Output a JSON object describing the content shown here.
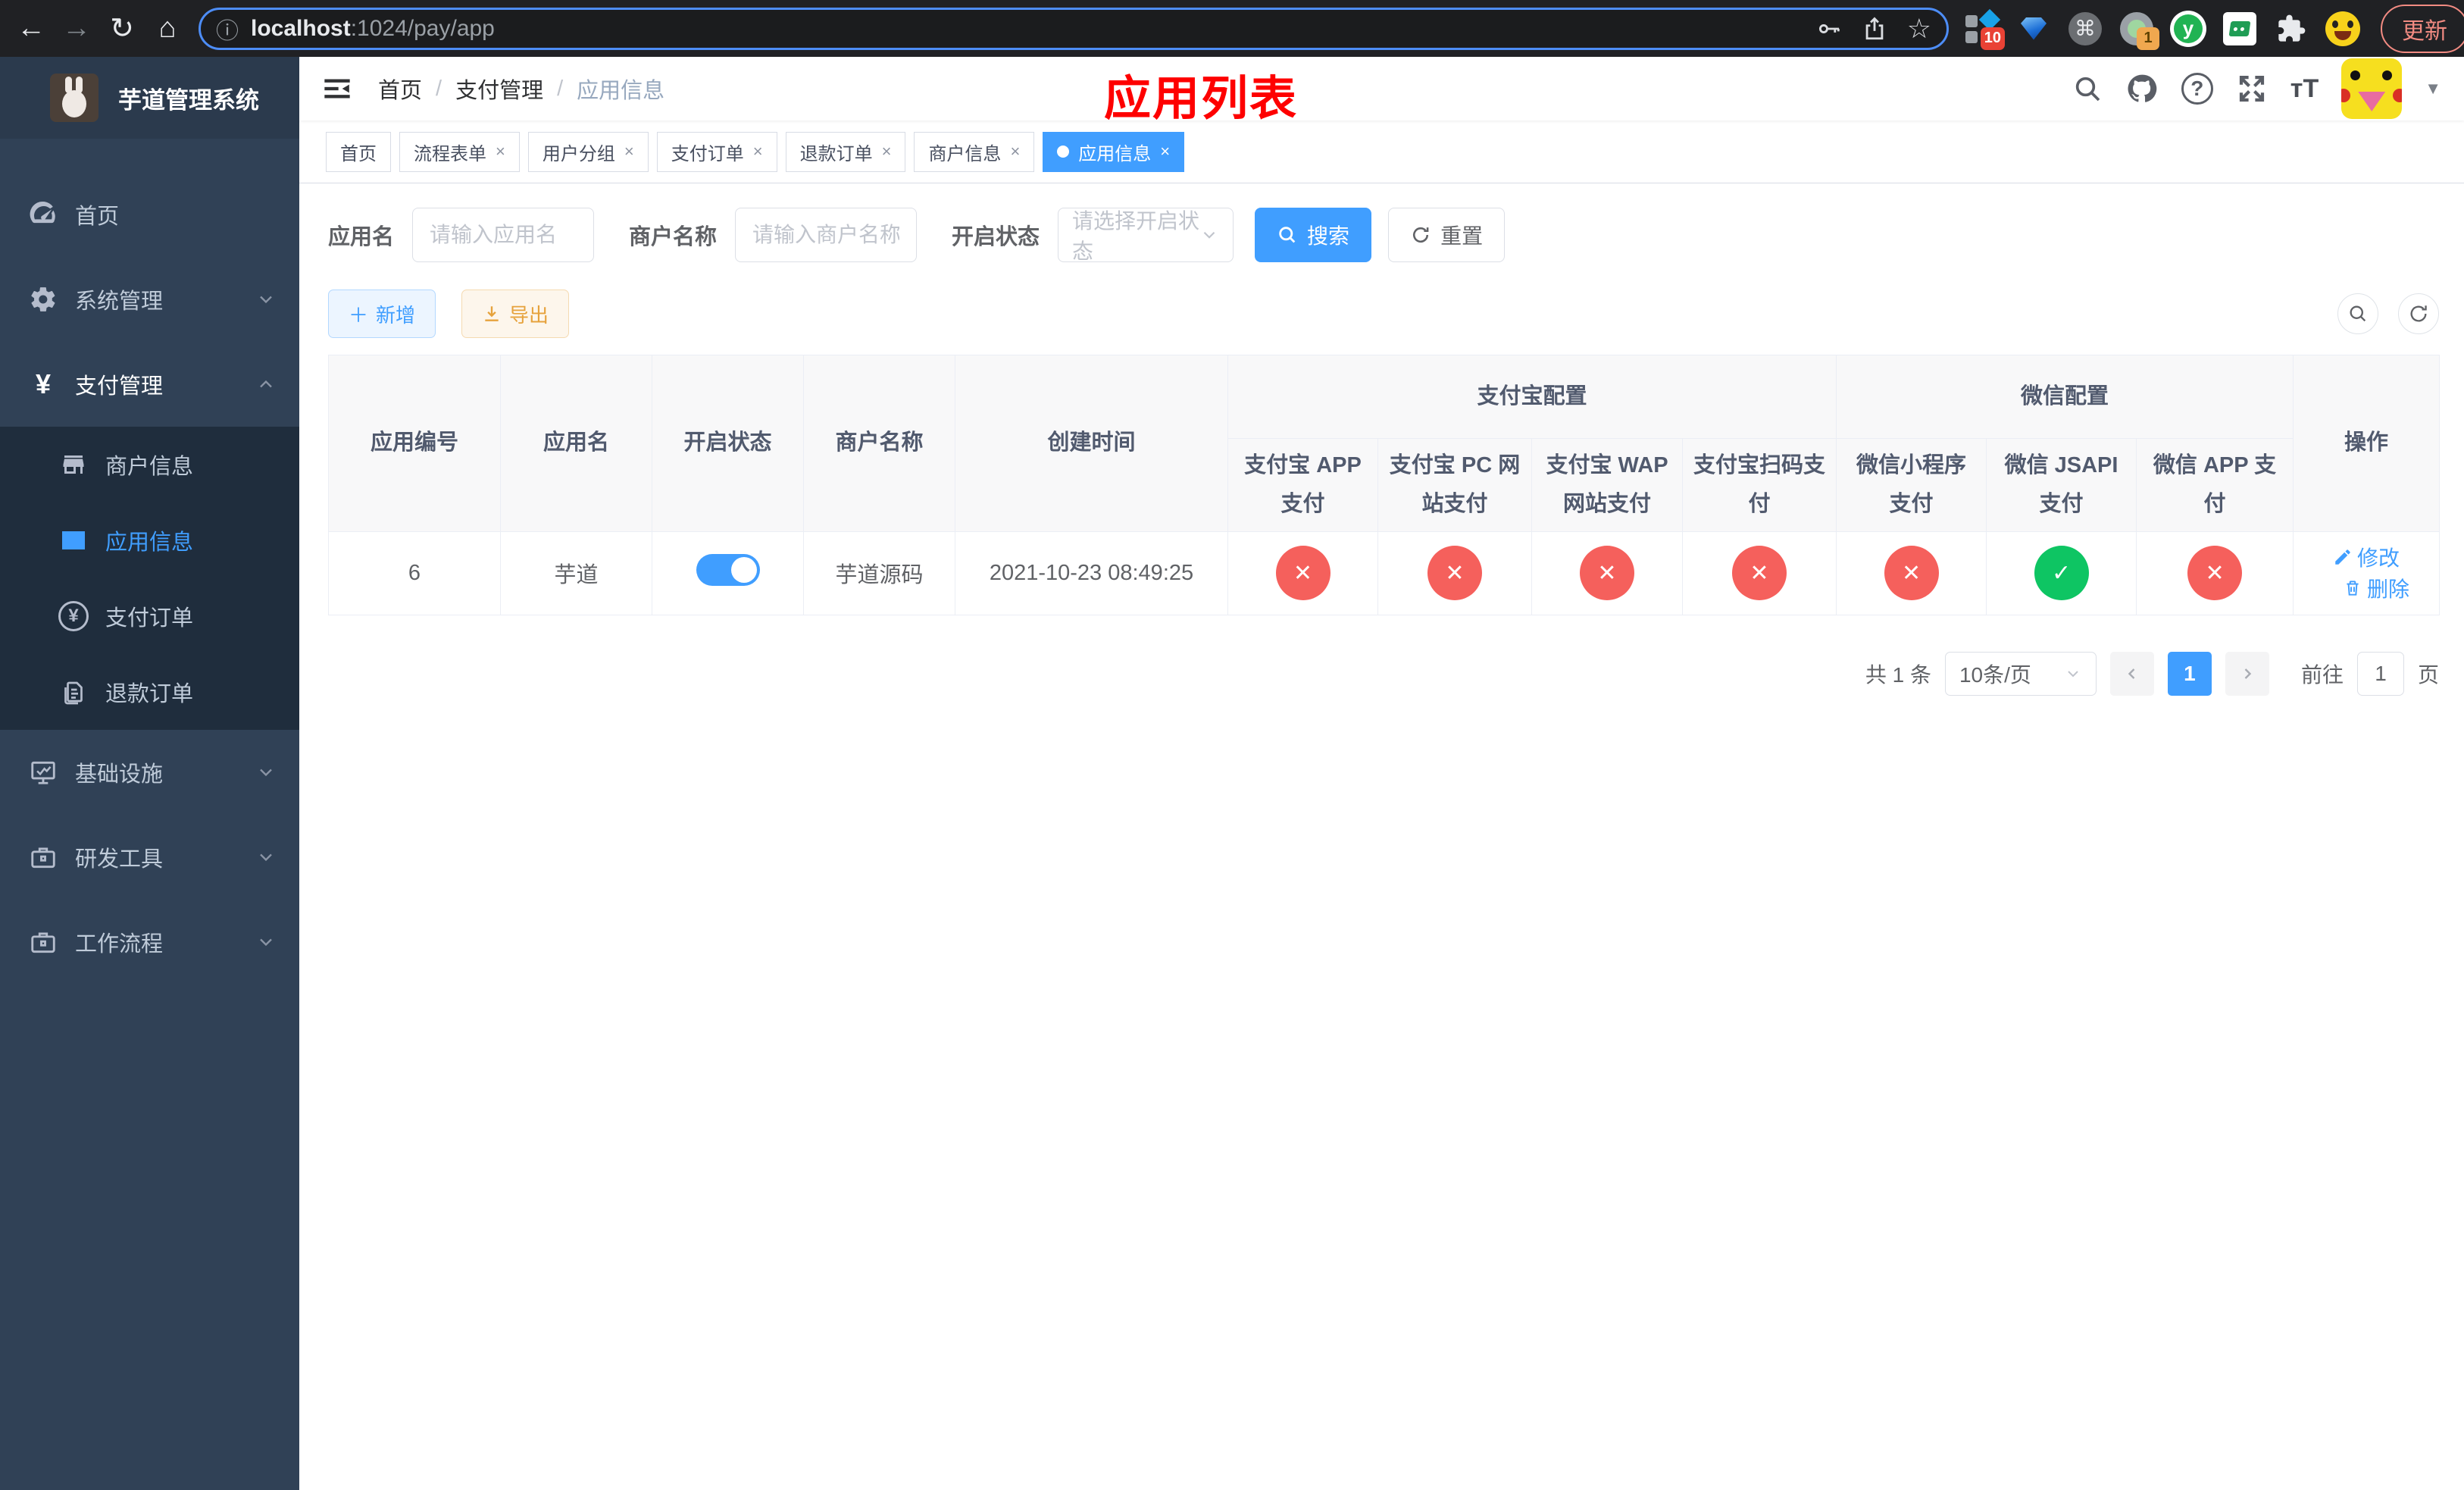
{
  "colors": {
    "primary": "#409eff",
    "success": "#0ec563",
    "danger": "#f5605c",
    "sidebar": "#304156",
    "submenu": "#1f2d3d"
  },
  "icons": {
    "back": "←",
    "forward": "→",
    "reload": "↻",
    "home": "⌂",
    "info": "ⓘ",
    "star": "☆",
    "cmd": "⌘",
    "dots": "⋮",
    "yen": "¥",
    "caret": "▼",
    "check": "✓",
    "cross": "✕",
    "plus": "＋",
    "font_size": "тT",
    "ext_y": "y",
    "question": "?"
  },
  "browser": {
    "url_host": "localhost",
    "url_path": ":1024/pay/app",
    "ext_badge_blocker": "10",
    "ext_badge_proxy": "1",
    "update_label": "更新"
  },
  "sidebar": {
    "title": "芋道管理系统",
    "home": "首页",
    "system": "系统管理",
    "payment": "支付管理",
    "merchant_info": "商户信息",
    "app_info": "应用信息",
    "pay_order": "支付订单",
    "refund_order": "退款订单",
    "infra": "基础设施",
    "dev_tools": "研发工具",
    "workflow": "工作流程"
  },
  "breadcrumb": {
    "items": [
      "首页",
      "支付管理",
      "应用信息"
    ],
    "separator": "/"
  },
  "annotation": "应用列表",
  "tabs": [
    {
      "label": "首页",
      "closable": false,
      "active": false
    },
    {
      "label": "流程表单",
      "closable": true,
      "active": false
    },
    {
      "label": "用户分组",
      "closable": true,
      "active": false
    },
    {
      "label": "支付订单",
      "closable": true,
      "active": false
    },
    {
      "label": "退款订单",
      "closable": true,
      "active": false
    },
    {
      "label": "商户信息",
      "closable": true,
      "active": false
    },
    {
      "label": "应用信息",
      "closable": true,
      "active": true
    }
  ],
  "tab_close": "×",
  "filters": {
    "app_name_label": "应用名",
    "app_name_placeholder": "请输入应用名",
    "merchant_label": "商户名称",
    "merchant_placeholder": "请输入商户名称",
    "status_label": "开启状态",
    "status_placeholder": "请选择开启状态",
    "search_label": "搜索",
    "reset_label": "重置"
  },
  "toolbar": {
    "add_label": "新增",
    "export_label": "导出"
  },
  "table": {
    "main_columns": [
      "应用编号",
      "应用名",
      "开启状态",
      "商户名称",
      "创建时间"
    ],
    "group_alipay": "支付宝配置",
    "group_wechat": "微信配置",
    "sub_columns": [
      "支付宝 APP 支付",
      "支付宝 PC 网站支付",
      "支付宝 WAP 网站支付",
      "支付宝扫码支付",
      "微信小程序支付",
      "微信 JSAPI 支付",
      "微信 APP 支付"
    ],
    "op_column": "操作",
    "row": {
      "id": "6",
      "name": "芋道",
      "enabled": true,
      "merchant": "芋道源码",
      "created": "2021-10-23 08:49:25",
      "statuses": [
        false,
        false,
        false,
        false,
        false,
        true,
        false
      ],
      "edit_label": "修改",
      "delete_label": "删除"
    }
  },
  "pagination": {
    "total": "共 1 条",
    "page_size": "10条/页",
    "current_page": "1",
    "goto_label": "前往",
    "goto_value": "1",
    "goto_unit": "页"
  }
}
